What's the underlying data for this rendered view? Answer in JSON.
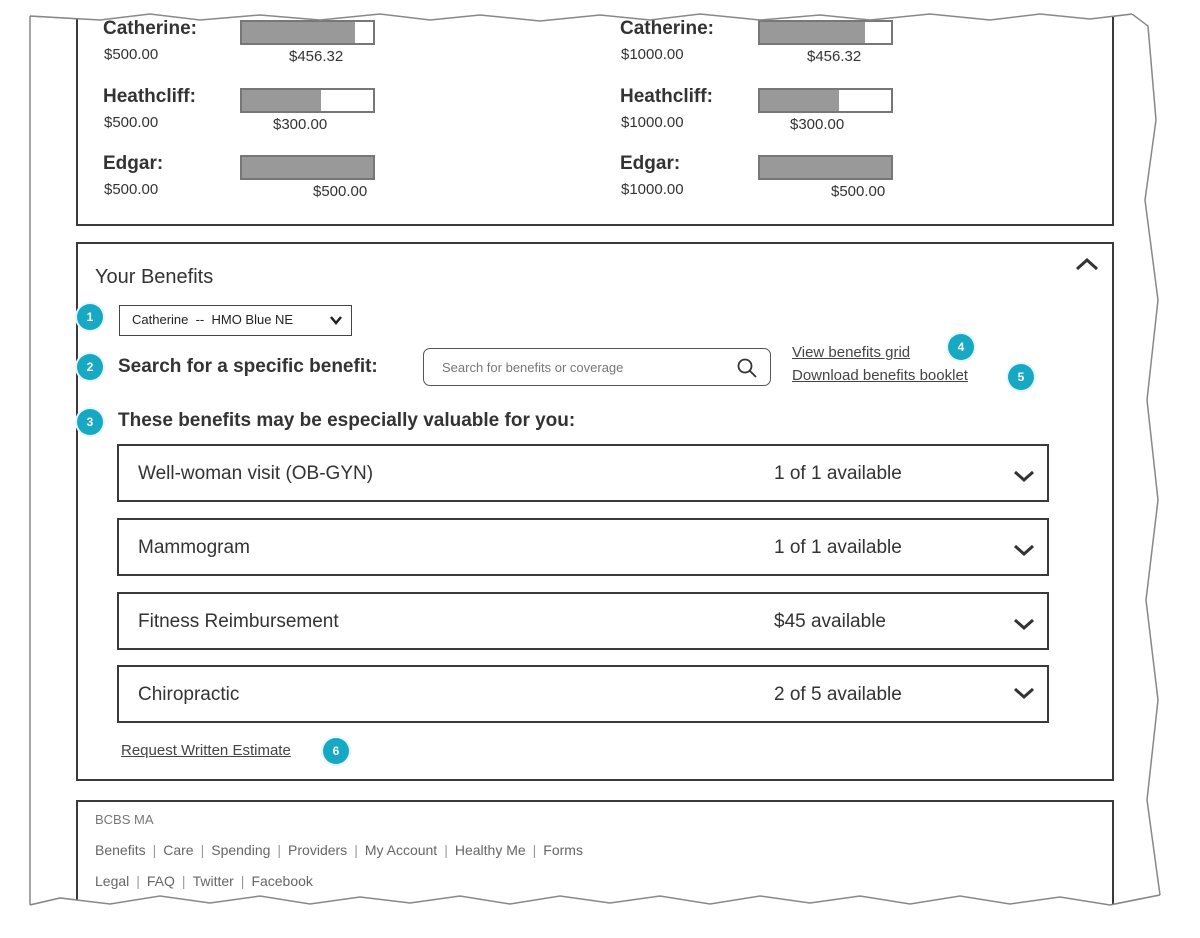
{
  "accumulators": {
    "left": [
      {
        "name": "Catherine:",
        "total": "$500.00",
        "used": "$456.32",
        "fraction": 0.86
      },
      {
        "name": "Heathcliff:",
        "total": "$500.00",
        "used": "$300.00",
        "fraction": 0.6
      },
      {
        "name": "Edgar:",
        "total": "$500.00",
        "used": "$500.00",
        "fraction": 1.0
      }
    ],
    "right": [
      {
        "name": "Catherine:",
        "total": "$1000.00",
        "used": "$456.32",
        "fraction": 0.8
      },
      {
        "name": "Heathcliff:",
        "total": "$1000.00",
        "used": "$300.00",
        "fraction": 0.6
      },
      {
        "name": "Edgar:",
        "total": "$1000.00",
        "used": "$500.00",
        "fraction": 1.0
      }
    ]
  },
  "benefits": {
    "title": "Your Benefits",
    "member_select": {
      "value": "Catherine  --  HMO Blue NE"
    },
    "search": {
      "label": "Search for a specific benefit:",
      "placeholder": "Search for benefits or coverage"
    },
    "links": {
      "grid": "View benefits grid",
      "booklet": "Download benefits booklet"
    },
    "valuable_heading": "These benefits may be especially valuable for you:",
    "items": [
      {
        "name": "Well-woman visit (OB-GYN)",
        "availability": "1 of 1 available"
      },
      {
        "name": "Mammogram",
        "availability": "1 of 1 available"
      },
      {
        "name": "Fitness Reimbursement",
        "availability": "$45 available"
      },
      {
        "name": "Chiropractic",
        "availability": "2 of 5 available"
      }
    ],
    "estimate_link": "Request Written Estimate"
  },
  "annotations": [
    "1",
    "2",
    "3",
    "4",
    "5",
    "6"
  ],
  "footer": {
    "brand": "BCBS MA",
    "row1": [
      "Benefits",
      "Care",
      "Spending",
      "Providers",
      "My Account",
      "Healthy Me",
      "Forms"
    ],
    "row2": [
      "Legal",
      "FAQ",
      "Twitter",
      "Facebook"
    ]
  },
  "colors": {
    "annotation": "#17a9c4",
    "bar_fill": "#999999",
    "border": "#3a3a3a"
  },
  "icons": {
    "search": "search-icon",
    "chevron": "chevron-down-icon",
    "collapse": "chevron-up-icon"
  }
}
